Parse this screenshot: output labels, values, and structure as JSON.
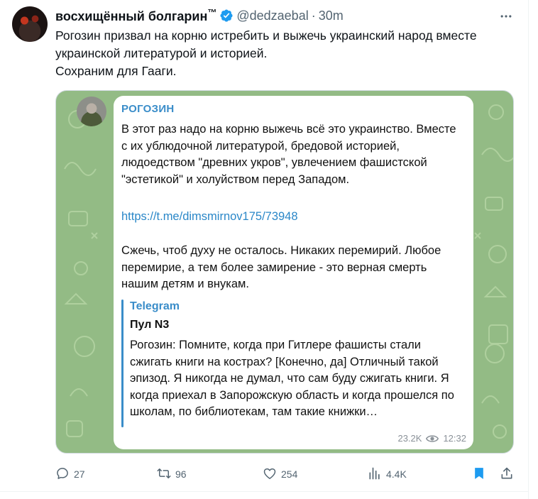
{
  "author": {
    "display_name": "восхищённый болгарин",
    "trademark": "™",
    "handle": "@dedzaebal",
    "separator": "·",
    "time": "30m"
  },
  "tweet": {
    "line1": "Рогозин призвал на корню истребить и выжечь украинский народ вместе украинской литературой и историей.",
    "line2": "Сохраним для Гааги."
  },
  "telegram_post": {
    "sender": "РОГОЗИН",
    "paragraph1": "В этот раз надо на корню выжечь всё это украинство. Вместе с их ублюдочной литературой, бредовой историей, людоедством \"древних укров\", увлечением фашистской \"эстетикой\" и холуйством перед Западом.",
    "link": "https://t.me/dimsmirnov175/73948",
    "paragraph2": "Сжечь, чтоб духу не осталось. Никаких перемирий. Любое перемирие, а тем более замирение - это верная смерть нашим детям и внукам.",
    "quote_source": "Telegram",
    "quote_title": "Пул N3",
    "quote_text": "Рогозин: Помните, когда при Гитлере фашисты стали сжигать книги на кострах? [Конечно, да] Отличный такой эпизод. Я никогда не думал, что сам буду сжигать книги. Я когда приехал в Запорожскую область и когда прошелся по школам, по библиотекам, там такие книжки…",
    "views": "23.2K",
    "time": "12:32"
  },
  "actions": {
    "replies": "27",
    "reposts": "96",
    "likes": "254",
    "views": "4.4K"
  },
  "colors": {
    "verified": "#1d9bf0",
    "telegram_accent": "#3a8dc9",
    "bookmark_active": "#1d9bf0",
    "media_background": "#93bb85"
  }
}
